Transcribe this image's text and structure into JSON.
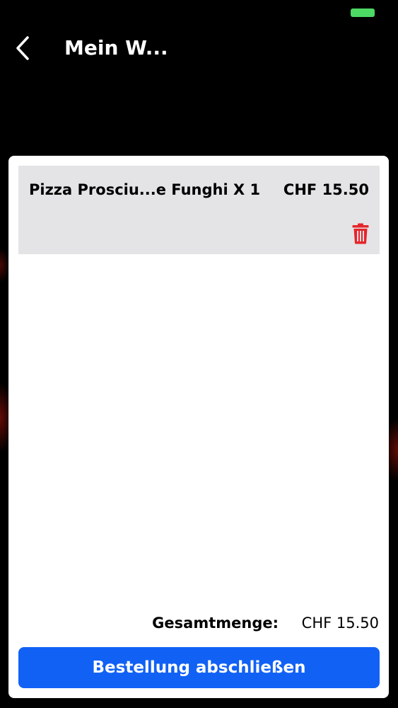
{
  "header": {
    "title": "Mein W..."
  },
  "cart": {
    "items": [
      {
        "name": "Pizza Prosciu...e Funghi X 1",
        "price": "CHF 15.50"
      }
    ]
  },
  "summary": {
    "total_label": "Gesamtmenge:",
    "total_value": "CHF 15.50"
  },
  "actions": {
    "checkout_label": "Bestellung abschließen"
  },
  "colors": {
    "background": "#000000",
    "item_background": "#e4e3e6",
    "primary_button": "#1161f5",
    "delete_icon": "#e5252a",
    "battery": "#4cd964"
  },
  "icons": {
    "back": "chevron-left-icon",
    "delete": "trash-icon",
    "battery": "battery-icon"
  }
}
